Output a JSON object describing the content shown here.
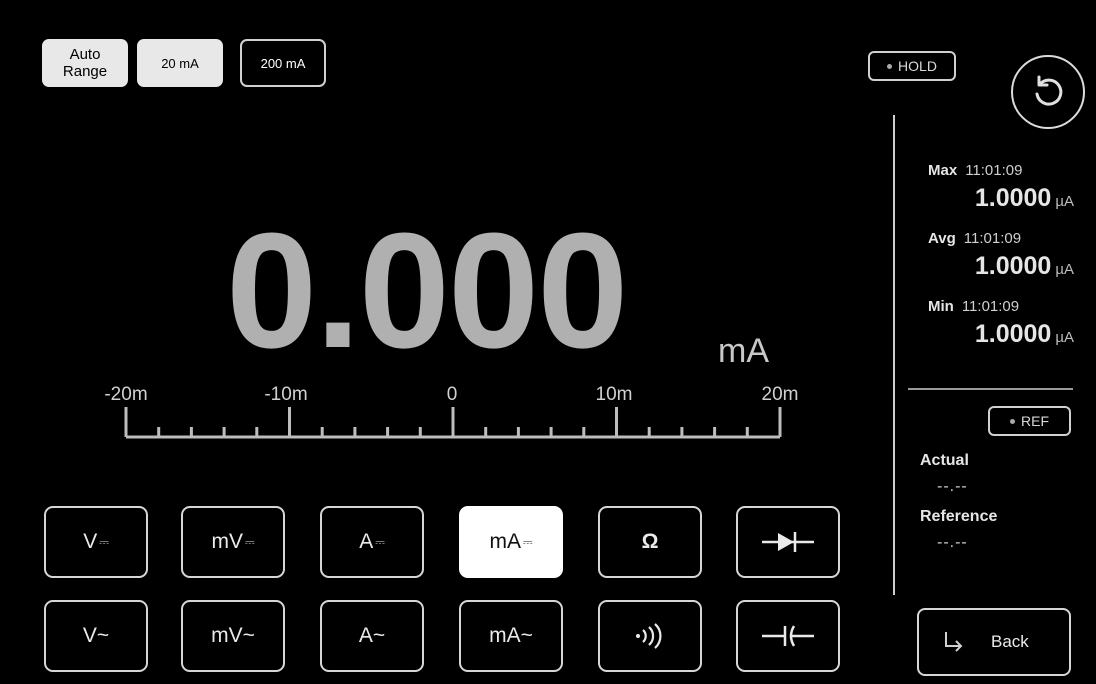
{
  "range": {
    "auto_label": "Auto\nRange",
    "r20_label": "20 mA",
    "r200_label": "200 mA"
  },
  "hold_label": "HOLD",
  "ref_label": "REF",
  "reset_icon": "rotate-ccw-icon",
  "stats": {
    "max": {
      "label": "Max",
      "time": "11:01:09",
      "value": "1.0000",
      "unit": "µA"
    },
    "avg": {
      "label": "Avg",
      "time": "11:01:09",
      "value": "1.0000",
      "unit": "µA"
    },
    "min": {
      "label": "Min",
      "time": "11:01:09",
      "value": "1.0000",
      "unit": "µA"
    }
  },
  "reading": {
    "value": "0.000",
    "unit": "mA"
  },
  "scale": {
    "labels": [
      "-20m",
      "-10m",
      "0",
      "10m",
      "20m"
    ]
  },
  "reference": {
    "actual_label": "Actual",
    "actual_value": "--.--",
    "reference_label": "Reference",
    "reference_value": "--.--"
  },
  "functions": {
    "row1": [
      {
        "label": "V",
        "sym": "dc"
      },
      {
        "label": "mV",
        "sym": "dc"
      },
      {
        "label": "A",
        "sym": "dc"
      },
      {
        "label": "mA",
        "sym": "dc",
        "active": true
      },
      {
        "label": "Ω",
        "sym": ""
      },
      {
        "label": "",
        "sym": "diode-icon"
      }
    ],
    "row2": [
      {
        "label": "V~",
        "sym": "ac"
      },
      {
        "label": "mV~",
        "sym": "ac"
      },
      {
        "label": "A~",
        "sym": "ac"
      },
      {
        "label": "mA~",
        "sym": "ac"
      },
      {
        "label": "",
        "sym": "continuity-icon"
      },
      {
        "label": "",
        "sym": "capacitor-icon"
      }
    ]
  },
  "back_label": "Back",
  "colors": {
    "background": "#000000",
    "reading": "#b0b0b0",
    "active_button": "#ffffff"
  }
}
